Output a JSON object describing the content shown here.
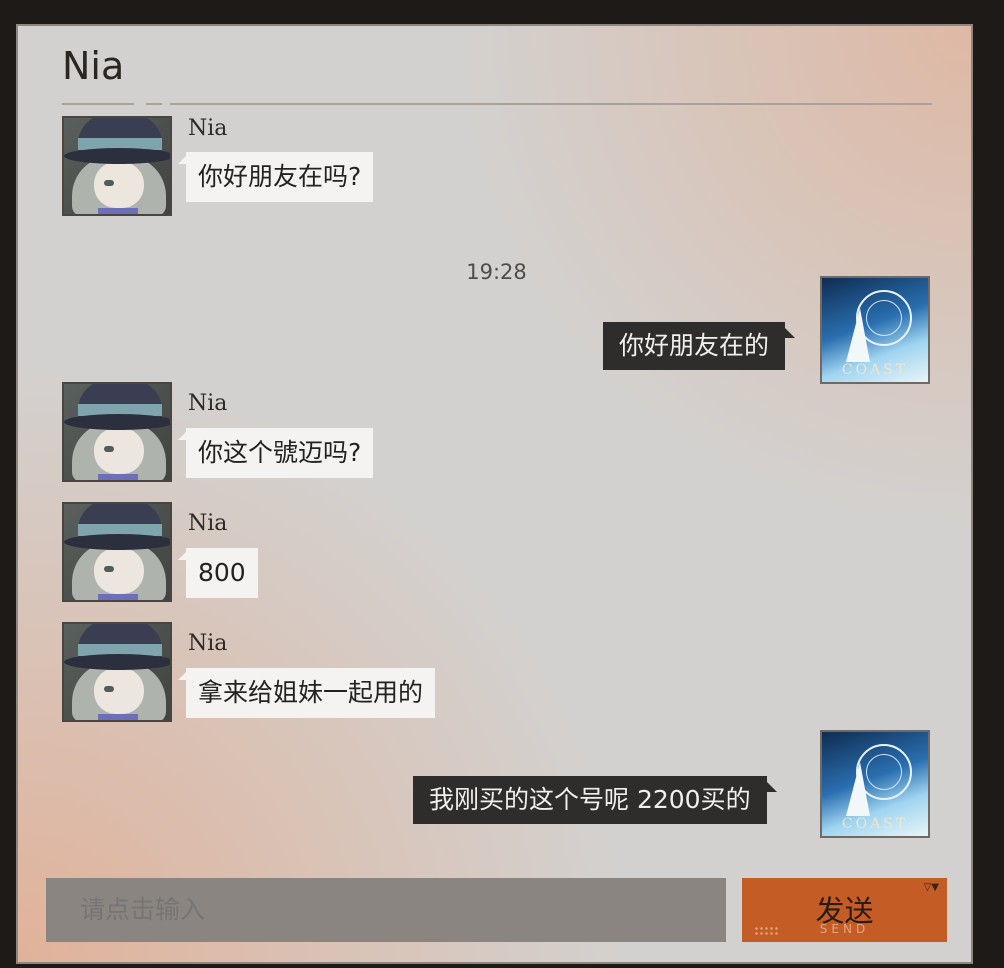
{
  "chat": {
    "title": "Nia",
    "timestamp": "19:28",
    "contact_name": "Nia",
    "my_avatar_text": "COAST",
    "messages": [
      {
        "from": "Nia",
        "text": "你好朋友在吗?"
      },
      {
        "from": "me",
        "text": "你好朋友在的"
      },
      {
        "from": "Nia",
        "text": "你这个號迈吗?"
      },
      {
        "from": "Nia",
        "text": "800"
      },
      {
        "from": "Nia",
        "text": "拿来给姐妹一起用的"
      },
      {
        "from": "me",
        "text": "我刚买的这个号呢 2200买的"
      }
    ]
  },
  "composer": {
    "placeholder": "请点击输入",
    "send_label": "发送",
    "send_sub_label": "SEND",
    "corner_mark": "▽▼"
  },
  "colors": {
    "send_button": "#c45c26",
    "my_bubble": "#2f2d2b",
    "their_bubble": "#f4f3f1",
    "panel": "#d3d1cf"
  },
  "icons": {
    "contact_avatar": "nia-avatar",
    "my_avatar": "coast-avatar"
  }
}
